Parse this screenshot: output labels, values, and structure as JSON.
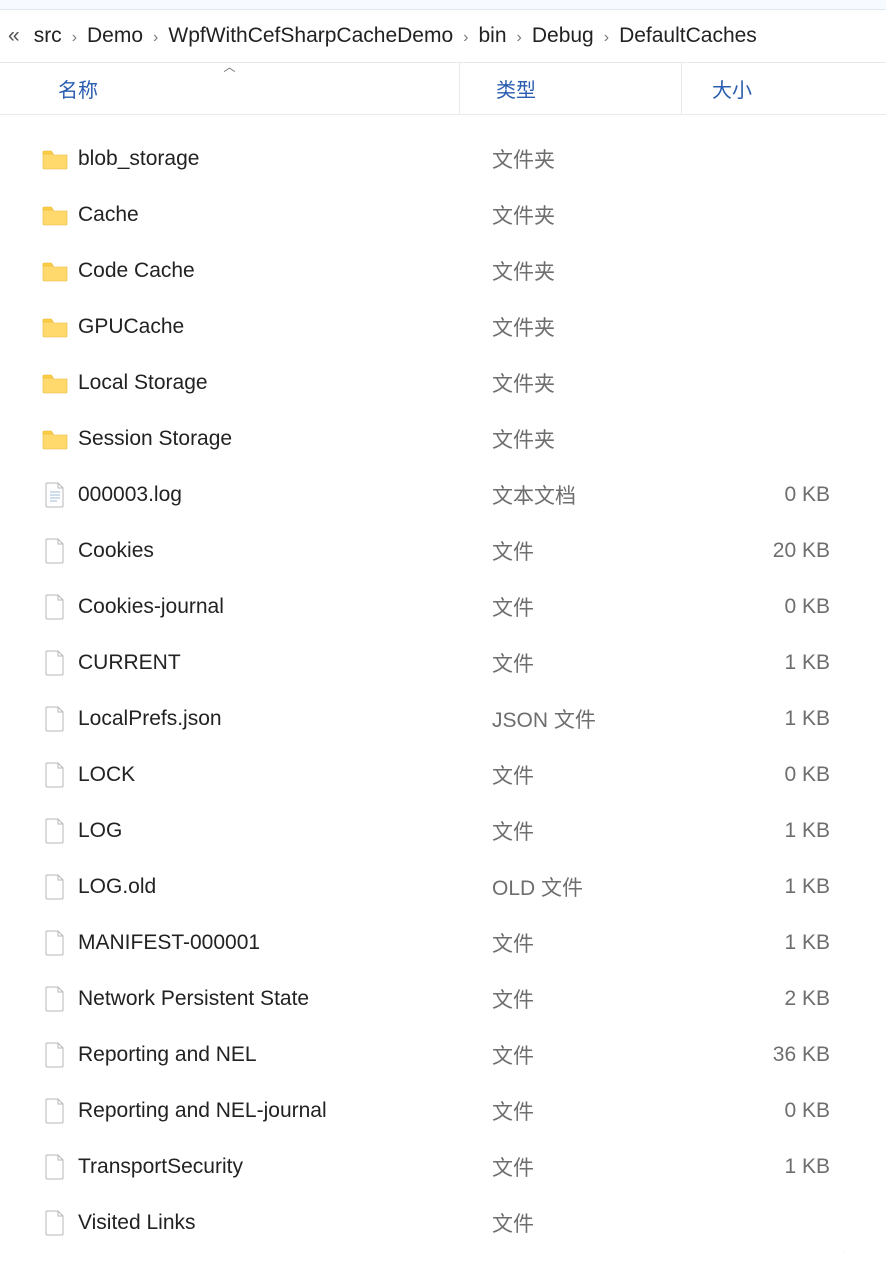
{
  "breadcrumb": {
    "more": "«",
    "items": [
      "src",
      "Demo",
      "WpfWithCefSharpCacheDemo",
      "bin",
      "Debug",
      "DefaultCaches"
    ]
  },
  "columns": {
    "name": "名称",
    "type": "类型",
    "size": "大小",
    "sort": "name-asc"
  },
  "type_labels": {
    "folder": "文件夹",
    "file": "文件",
    "text": "文本文档",
    "json": "JSON 文件",
    "old": "OLD 文件"
  },
  "items": [
    {
      "name": "blob_storage",
      "type_key": "folder",
      "icon": "folder",
      "size": ""
    },
    {
      "name": "Cache",
      "type_key": "folder",
      "icon": "folder",
      "size": ""
    },
    {
      "name": "Code Cache",
      "type_key": "folder",
      "icon": "folder",
      "size": ""
    },
    {
      "name": "GPUCache",
      "type_key": "folder",
      "icon": "folder",
      "size": ""
    },
    {
      "name": "Local Storage",
      "type_key": "folder",
      "icon": "folder",
      "size": ""
    },
    {
      "name": "Session Storage",
      "type_key": "folder",
      "icon": "folder",
      "size": ""
    },
    {
      "name": "000003.log",
      "type_key": "text",
      "icon": "textfile",
      "size": "0 KB"
    },
    {
      "name": "Cookies",
      "type_key": "file",
      "icon": "file",
      "size": "20 KB"
    },
    {
      "name": "Cookies-journal",
      "type_key": "file",
      "icon": "file",
      "size": "0 KB"
    },
    {
      "name": "CURRENT",
      "type_key": "file",
      "icon": "file",
      "size": "1 KB"
    },
    {
      "name": "LocalPrefs.json",
      "type_key": "json",
      "icon": "file",
      "size": "1 KB"
    },
    {
      "name": "LOCK",
      "type_key": "file",
      "icon": "file",
      "size": "0 KB"
    },
    {
      "name": "LOG",
      "type_key": "file",
      "icon": "file",
      "size": "1 KB"
    },
    {
      "name": "LOG.old",
      "type_key": "old",
      "icon": "file",
      "size": "1 KB"
    },
    {
      "name": "MANIFEST-000001",
      "type_key": "file",
      "icon": "file",
      "size": "1 KB"
    },
    {
      "name": "Network Persistent State",
      "type_key": "file",
      "icon": "file",
      "size": "2 KB"
    },
    {
      "name": "Reporting and NEL",
      "type_key": "file",
      "icon": "file",
      "size": "36 KB"
    },
    {
      "name": "Reporting and NEL-journal",
      "type_key": "file",
      "icon": "file",
      "size": "0 KB"
    },
    {
      "name": "TransportSecurity",
      "type_key": "file",
      "icon": "file",
      "size": "1 KB"
    },
    {
      "name": "Visited Links",
      "type_key": "file",
      "icon": "file",
      "size": ""
    }
  ],
  "watermark": {
    "l1": "开发者",
    "l2": "DevZe.CoM"
  }
}
